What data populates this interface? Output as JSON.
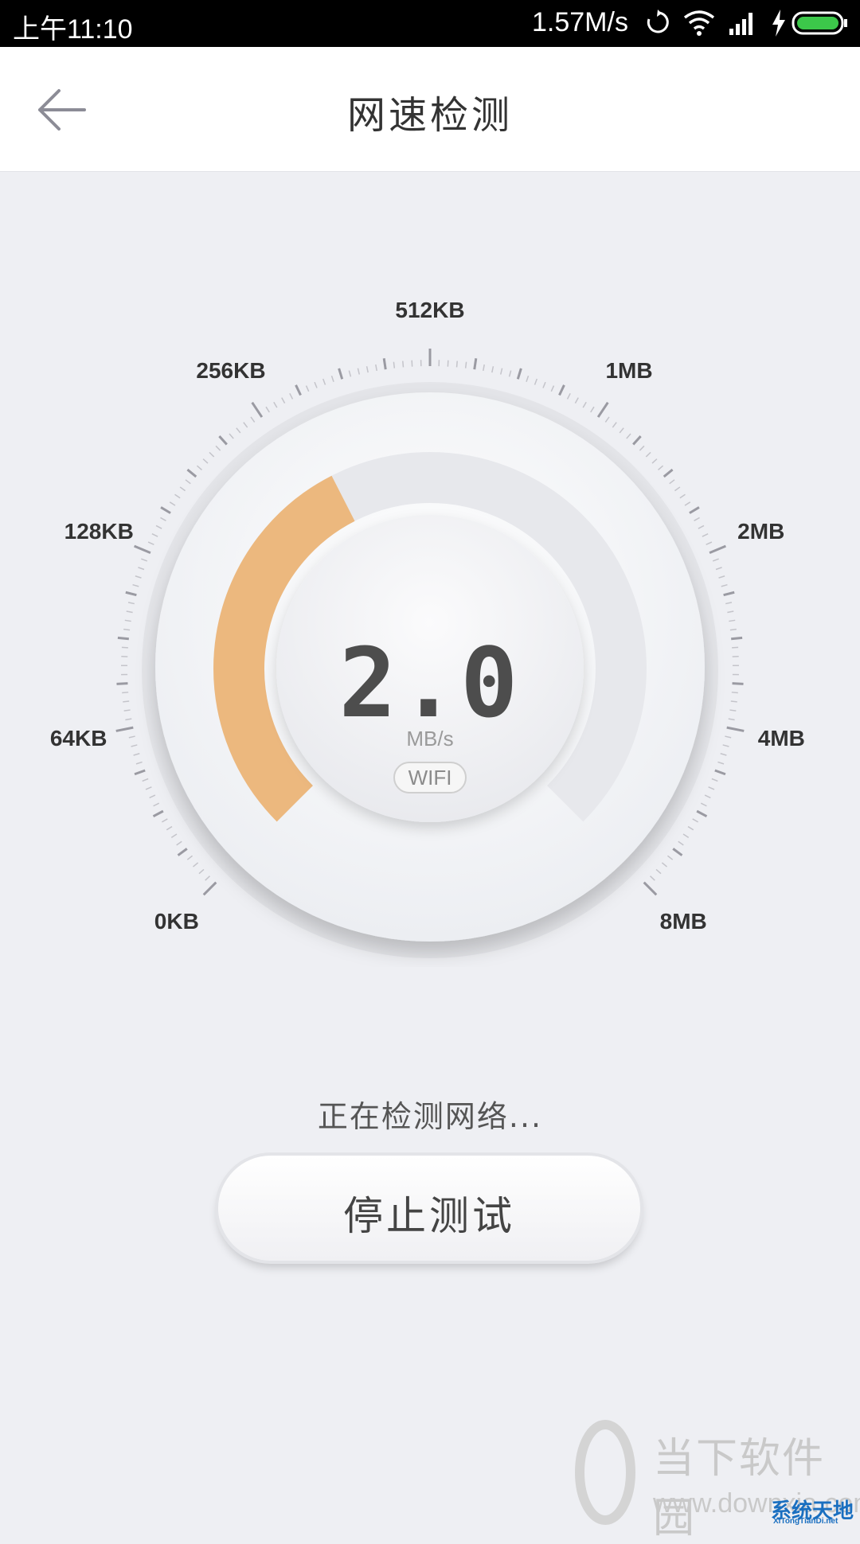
{
  "status_bar": {
    "time": "上午11:10",
    "net_speed": "1.57M/s",
    "icons": [
      "sync-icon",
      "wifi-icon",
      "signal-icon",
      "charging-icon",
      "battery-icon"
    ]
  },
  "header": {
    "title": "网速检测",
    "back_icon": "back-arrow-icon"
  },
  "gauge": {
    "scale_labels": [
      "0KB",
      "64KB",
      "128KB",
      "256KB",
      "512KB",
      "1MB",
      "2MB",
      "4MB",
      "8MB"
    ],
    "progress_fraction": 0.4,
    "readout": "2.0",
    "unit": "MB/s",
    "network_type": "WIFI",
    "accent_color": "#ecb87e"
  },
  "status_message": "正在检测网络...",
  "stop_button": {
    "label": "停止测试"
  },
  "watermark": {
    "brand": "当下软件园",
    "url": "www.downxia.com",
    "corner_brand": "系统天地",
    "corner_url": "XiTongTianDi.net"
  }
}
